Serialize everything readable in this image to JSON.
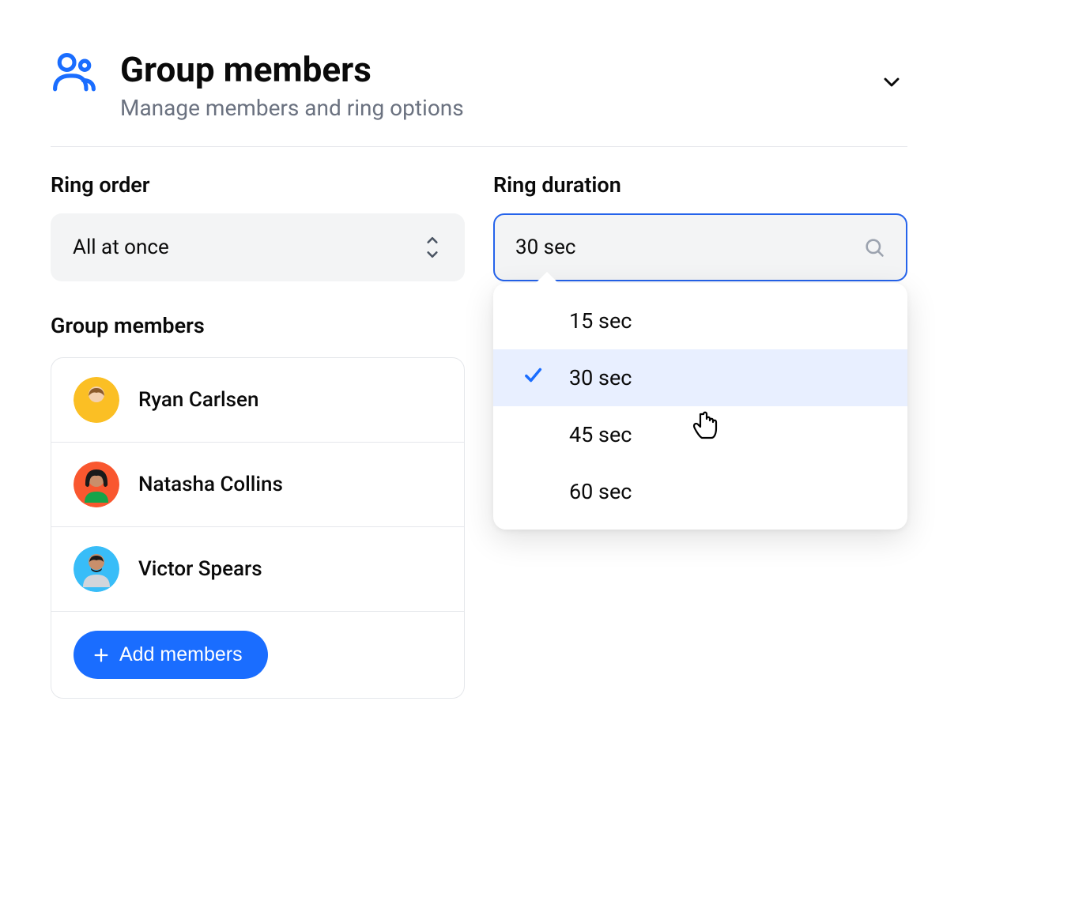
{
  "header": {
    "title": "Group members",
    "subtitle": "Manage members and ring options"
  },
  "ring_order": {
    "label": "Ring order",
    "value": "All at once"
  },
  "ring_duration": {
    "label": "Ring duration",
    "value": "30 sec",
    "options": [
      "15 sec",
      "30 sec",
      "45 sec",
      "60 sec"
    ],
    "selected_index": 1
  },
  "members_section": {
    "label": "Group members"
  },
  "members": [
    {
      "name": "Ryan Carlsen",
      "avatar_bg": "#fbbf24"
    },
    {
      "name": "Natasha Collins",
      "avatar_bg": "#f9572f"
    },
    {
      "name": "Victor Spears",
      "avatar_bg": "#38bdf8"
    }
  ],
  "add_button": {
    "label": "Add members"
  },
  "icons": {
    "group": "group-icon",
    "chevron_down": "chevron-down-icon",
    "updown": "updown-icon",
    "search": "search-icon",
    "check": "check-icon",
    "plus": "plus-icon"
  }
}
